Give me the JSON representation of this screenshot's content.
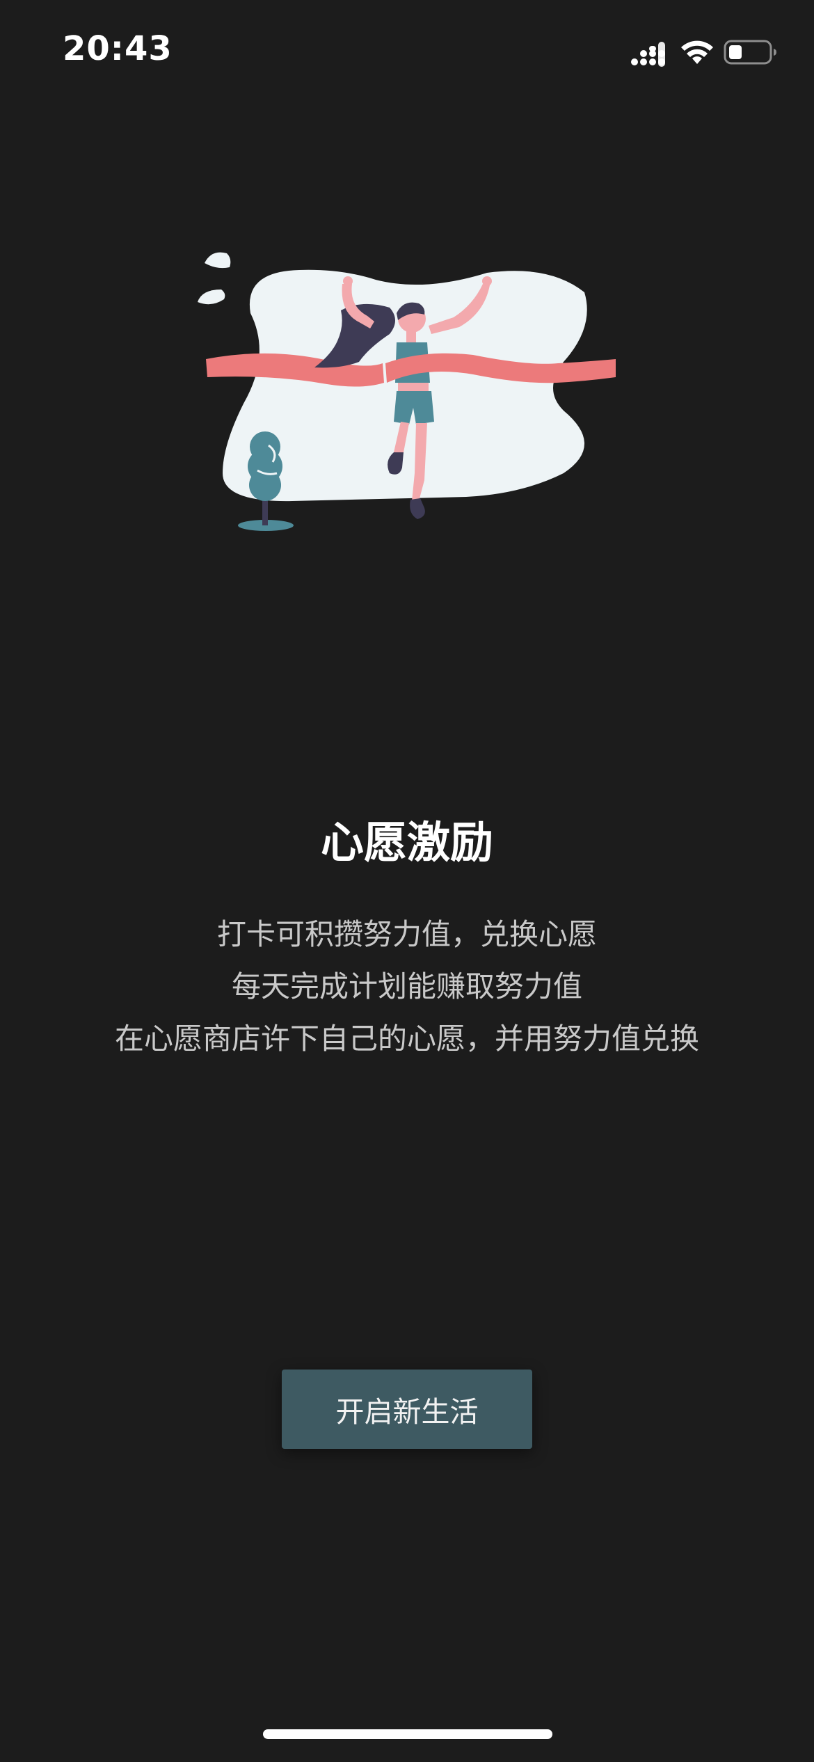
{
  "status_bar": {
    "time": "20:43",
    "icons": [
      "signal-icon",
      "wifi-icon",
      "battery-icon"
    ]
  },
  "illustration": {
    "subject": "runner-crossing-finish-line",
    "colors": {
      "blob": "#eef4f6",
      "ribbon": "#ec7a7b",
      "outfit": "#4e8a98",
      "hair": "#3e3b55",
      "skin": "#f3a9ad"
    }
  },
  "content": {
    "title": "心愿激励",
    "lines": [
      "打卡可积攒努力值，兑换心愿",
      "每天完成计划能赚取努力值",
      "在心愿商店许下自己的心愿，并用努力值兑换"
    ]
  },
  "cta": {
    "label": "开启新生活",
    "color": "#3e5a62"
  },
  "theme": {
    "background": "#1c1c1c",
    "title_color": "#ffffff",
    "text_color": "#c9c9c9"
  }
}
